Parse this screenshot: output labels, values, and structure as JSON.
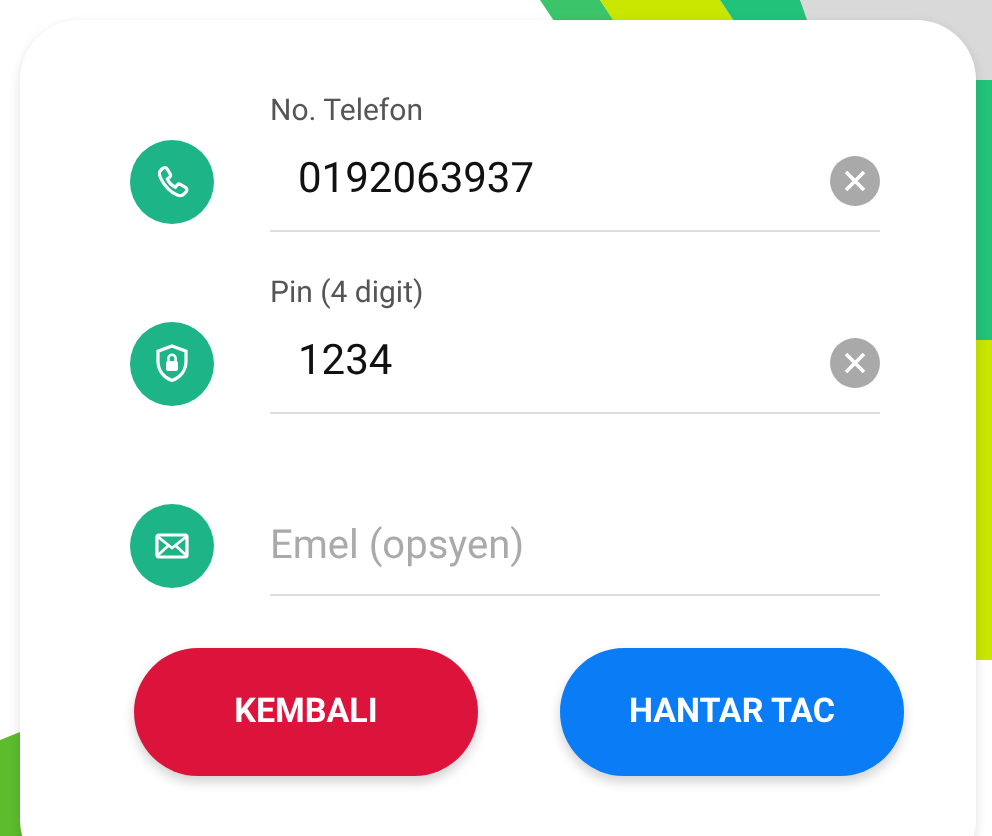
{
  "fields": [
    {
      "kind": "phone",
      "label": "No. Telefon",
      "value": "0192063937",
      "clearable": true
    },
    {
      "kind": "shield",
      "label": "Pin (4 digit)",
      "value": "1234",
      "clearable": true
    },
    {
      "kind": "mail",
      "placeholder": "Emel (opsyen)",
      "clearable": false
    }
  ],
  "buttons": [
    {
      "label": "KEMBALI",
      "kind": "secondary"
    },
    {
      "label": "HANTAR TAC",
      "kind": "primary"
    }
  ]
}
